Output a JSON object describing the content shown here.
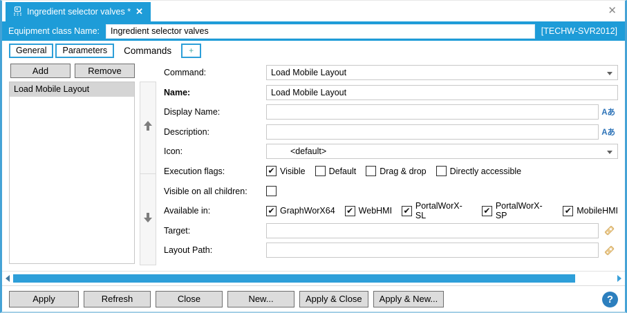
{
  "window": {
    "doc_tab": {
      "title": "Ingredient selector valves *",
      "close_glyph": "✕"
    },
    "close_glyph": "✕",
    "header": {
      "label": "Equipment class Name:",
      "value": "Ingredient selector valves",
      "server": "[TECHW-SVR2012]"
    },
    "tabs": [
      {
        "label": "General"
      },
      {
        "label": "Parameters"
      },
      {
        "label": "Commands"
      },
      {
        "label": "+"
      }
    ]
  },
  "commands_panel": {
    "add_label": "Add",
    "remove_label": "Remove",
    "list": [
      "Load Mobile Layout"
    ],
    "selected_index": 0
  },
  "form": {
    "command": {
      "label": "Command:",
      "value": "Load Mobile Layout"
    },
    "name": {
      "label": "Name:",
      "value": "Load Mobile Layout"
    },
    "display_name": {
      "label": "Display Name:",
      "value": ""
    },
    "description": {
      "label": "Description:",
      "value": ""
    },
    "icon": {
      "label": "Icon:",
      "value": "<default>"
    },
    "localize_glyph": "Aあ",
    "execution_flags": {
      "label": "Execution flags:",
      "options": [
        {
          "label": "Visible",
          "checked": true
        },
        {
          "label": "Default",
          "checked": false
        },
        {
          "label": "Drag & drop",
          "checked": false
        },
        {
          "label": "Directly accessible",
          "checked": false
        }
      ]
    },
    "visible_all_children": {
      "label": "Visible on all children:",
      "checked": false
    },
    "available_in": {
      "label": "Available in:",
      "options": [
        {
          "label": "GraphWorX64",
          "checked": true
        },
        {
          "label": "WebHMI",
          "checked": true
        },
        {
          "label": "PortalWorX-SL",
          "checked": true
        },
        {
          "label": "PortalWorX-SP",
          "checked": true
        },
        {
          "label": "MobileHMI",
          "checked": true
        }
      ]
    },
    "target": {
      "label": "Target:",
      "value": ""
    },
    "layout_path": {
      "label": "Layout Path:",
      "value": ""
    }
  },
  "footer": {
    "buttons": [
      "Apply",
      "Refresh",
      "Close",
      "New...",
      "Apply & Close",
      "Apply & New..."
    ],
    "help_glyph": "?"
  },
  "colors": {
    "accent_blue": "#1e9cd8",
    "scrollbar_blue": "#2e9fd9",
    "selection_gray": "#d5d5d5",
    "tag_icon": "#e6c285",
    "help_blue": "#2c7fbe"
  }
}
